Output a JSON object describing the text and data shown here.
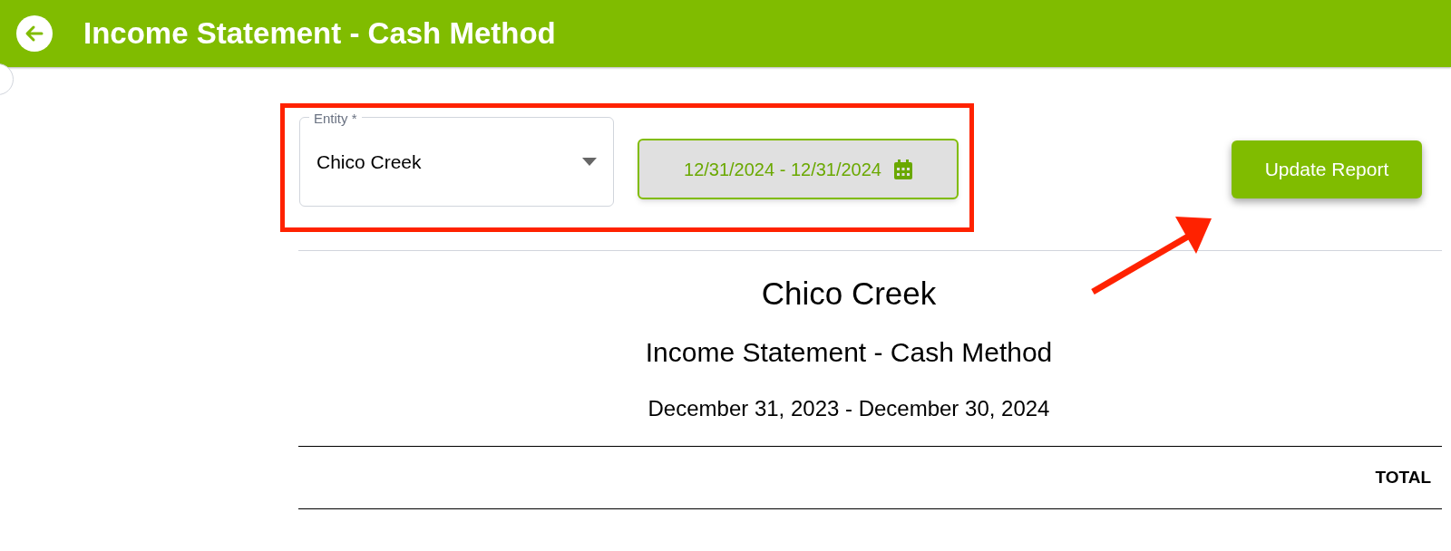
{
  "header": {
    "title": "Income Statement - Cash Method"
  },
  "filters": {
    "entity": {
      "label": "Entity *",
      "value": "Chico Creek"
    },
    "date_range": {
      "value": "12/31/2024 - 12/31/2024"
    }
  },
  "update_button": {
    "label": "Update Report"
  },
  "report": {
    "entity": "Chico Creek",
    "title": "Income Statement - Cash Method",
    "period": "December 31, 2023 - December 30, 2024",
    "columns": [
      "TOTAL"
    ]
  }
}
